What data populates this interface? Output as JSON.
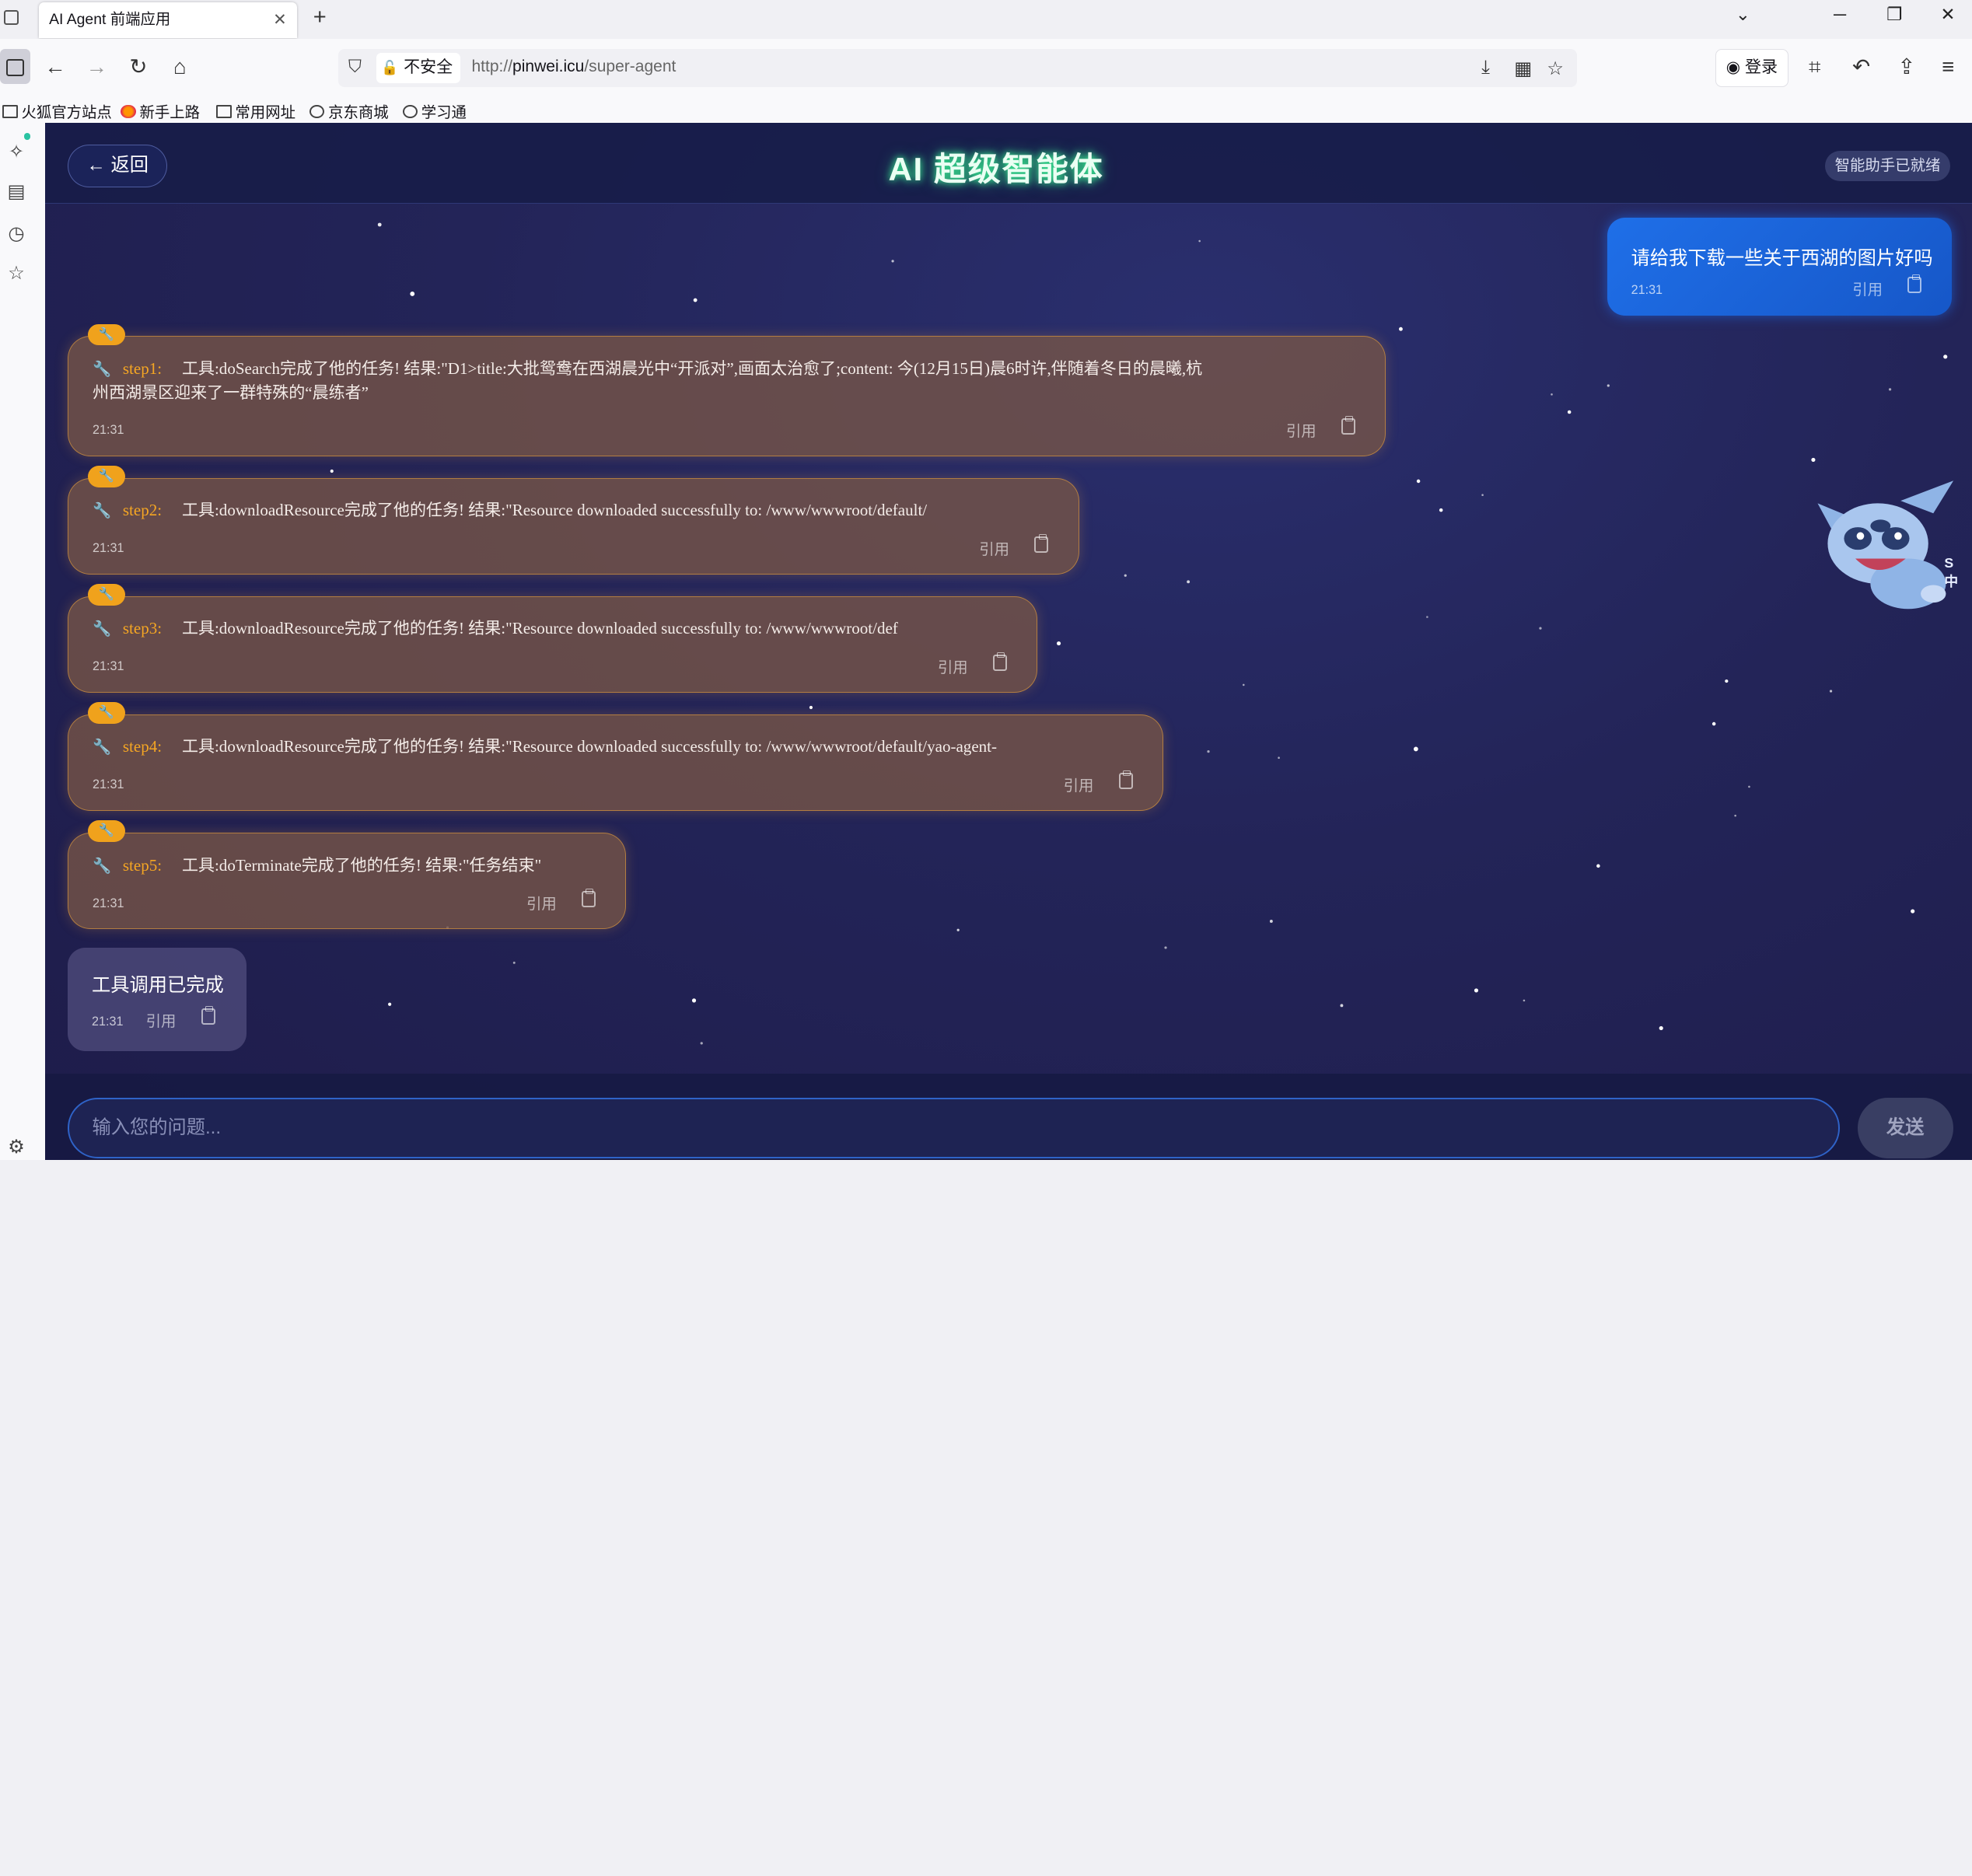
{
  "browser": {
    "tab_title": "AI Agent 前端应用",
    "tab_close": "✕",
    "new_tab": "+",
    "insecure_label": "不安全",
    "url_prefix": "http://",
    "url_host": "pinwei.icu",
    "url_path": "/super-agent",
    "login_label": "登录",
    "bookmarks": [
      "火狐官方站点",
      "新手上路",
      "常用网址",
      "京东商城",
      "学习通"
    ]
  },
  "app": {
    "back_label": "← 返回",
    "title": "AI 超级智能体",
    "status": "智能助手已就绪",
    "user_message": {
      "text": "请给我下载一些关于西湖的图片好吗",
      "time": "21:31",
      "quote": "引用"
    },
    "tool_messages": [
      {
        "step": "step1:",
        "text": "工具:doSearch完成了他的任务! 结果:\"D1>title:大批鸳鸯在西湖晨光中“开派对”,画面太治愈了;content: 今(12月15日)晨6时许,伴随着冬日的晨曦,杭",
        "text2": "州西湖景区迎来了一群特殊的“晨练者”",
        "time": "21:31",
        "quote": "引用"
      },
      {
        "step": "step2:",
        "text": "工具:downloadResource完成了他的任务! 结果:\"Resource downloaded successfully to: /www/wwwroot/default/",
        "time": "21:31",
        "quote": "引用"
      },
      {
        "step": "step3:",
        "text": "工具:downloadResource完成了他的任务! 结果:\"Resource downloaded successfully to: /www/wwwroot/def",
        "time": "21:31",
        "quote": "引用"
      },
      {
        "step": "step4:",
        "text": "工具:downloadResource完成了他的任务! 结果:\"Resource downloaded successfully to: /www/wwwroot/default/yao-agent-",
        "time": "21:31",
        "quote": "引用"
      },
      {
        "step": "step5:",
        "text": "工具:doTerminate完成了他的任务! 结果:\"任务结束\"",
        "time": "21:31",
        "quote": "引用"
      }
    ],
    "done_message": {
      "text": "工具调用已完成",
      "time": "21:31",
      "quote": "引用"
    },
    "input_placeholder": "输入您的问题...",
    "send_label": "发送",
    "mascot_side_text": "S 中"
  },
  "colors": {
    "accent": "#1f6fe8",
    "tool_border": "#e6a03c",
    "step_label": "#f5a623",
    "title_glow": "#3cff9a"
  }
}
